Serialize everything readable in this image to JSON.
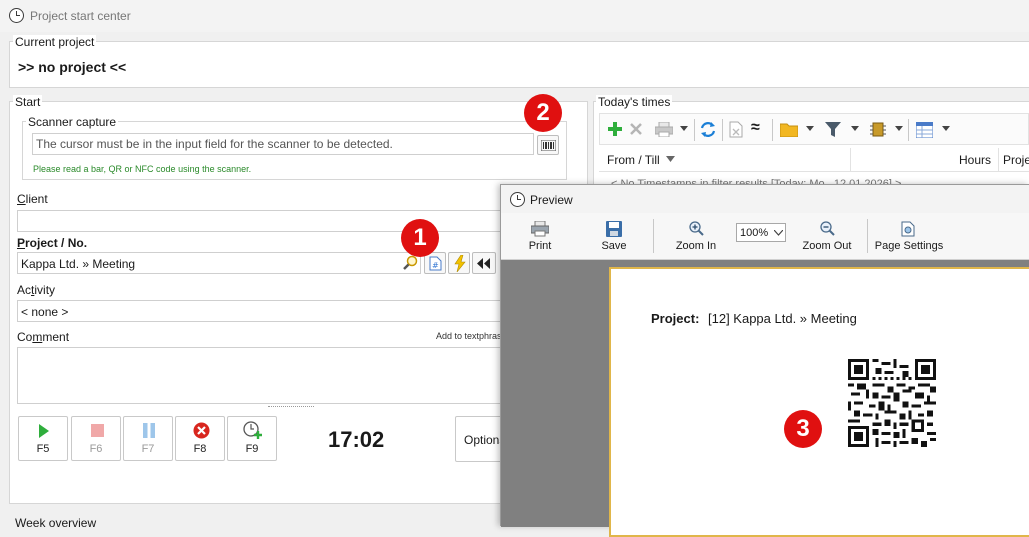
{
  "window": {
    "title": "Project start center"
  },
  "current_project": {
    "label": "Current project",
    "value": ">> no project <<"
  },
  "start": {
    "label": "Start",
    "scanner": {
      "label": "Scanner capture",
      "input_value": "The cursor must be in the input field for the scanner to be detected.",
      "hint": "Please read a bar, QR or NFC code using the scanner."
    },
    "client": {
      "label_first": "C",
      "label_rest": "lient",
      "value": ""
    },
    "project": {
      "label_first": "P",
      "label_rest": "roject / No.",
      "value": "Kappa Ltd. » Meeting"
    },
    "activity": {
      "label_pre": "Ac",
      "label_ul": "t",
      "label_post": "ivity",
      "value": "< none >"
    },
    "comment": {
      "label_pre": "Co",
      "label_ul": "m",
      "label_post": "ment",
      "add_text": "Add to textphrases"
    },
    "fkeys": [
      "F5",
      "F6",
      "F7",
      "F8",
      "F9"
    ],
    "time": "17:02",
    "options_label": "Options"
  },
  "todays_times": {
    "label": "Today's times",
    "columns": [
      "From / Till",
      "Hours",
      "Project"
    ],
    "filter_row": "< No Timestamps in filter results [Today: Mo., 12.01.2026] >"
  },
  "week_overview": {
    "label": "Week overview"
  },
  "badges": [
    "1",
    "2",
    "3"
  ],
  "preview": {
    "title": "Preview",
    "toolbar": {
      "print": "Print",
      "save": "Save",
      "zoom_in": "Zoom In",
      "zoom_value": "100%",
      "zoom_out": "Zoom Out",
      "page_settings": "Page Settings"
    },
    "doc": {
      "project_label": "Project:",
      "project_value": "[12] Kappa Ltd. » Meeting"
    }
  },
  "colors": {
    "accent": "#3a7bd5",
    "badge": "#e01010",
    "page_border": "#e0b64a",
    "hint_green": "#2a8a2a"
  }
}
